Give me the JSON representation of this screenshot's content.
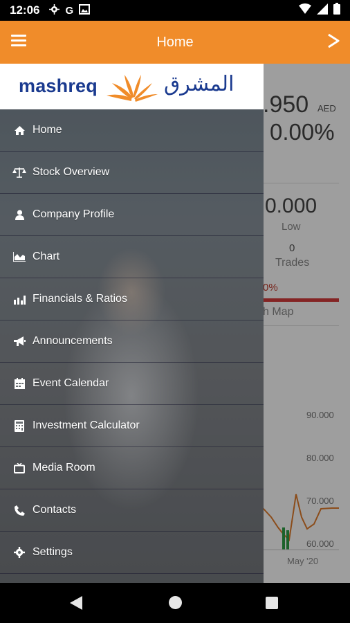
{
  "status_bar": {
    "time": "12:06",
    "icons": [
      "gear-icon",
      "google-icon",
      "photo-icon",
      "wifi-icon",
      "cellular-icon",
      "battery-icon"
    ],
    "google_letter": "G"
  },
  "app_bar": {
    "title": "Home",
    "menu_icon": "hamburger-icon",
    "share_icon": "chevron-right-icon",
    "color": "#f08c2a"
  },
  "drawer": {
    "brand_en": "mashreq",
    "brand_ar": "المشرق",
    "brand_color": "#1a3a8f",
    "items": [
      {
        "label": "Home",
        "icon": "home-icon"
      },
      {
        "label": "Stock Overview",
        "icon": "scale-icon"
      },
      {
        "label": "Company Profile",
        "icon": "person-icon"
      },
      {
        "label": "Chart",
        "icon": "area-chart-icon"
      },
      {
        "label": "Financials & Ratios",
        "icon": "bar-chart-icon"
      },
      {
        "label": "Announcements",
        "icon": "megaphone-icon"
      },
      {
        "label": "Event Calendar",
        "icon": "calendar-icon"
      },
      {
        "label": "Investment Calculator",
        "icon": "calculator-icon"
      },
      {
        "label": "Media Room",
        "icon": "tv-icon"
      },
      {
        "label": "Contacts",
        "icon": "phone-icon"
      },
      {
        "label": "Settings",
        "icon": "gear-icon"
      }
    ]
  },
  "main": {
    "price": ".950",
    "price_unit": "AED",
    "change": "0.00%",
    "low_value": "0.000",
    "low_label": "Low",
    "trades_value": "0",
    "trades_label": "Trades",
    "percent": "0%",
    "heat_map_label": "h Map",
    "y_ticks": [
      "90.000",
      "80.000",
      "70.000",
      "60.000"
    ],
    "x_tick": "May '20"
  },
  "nav_bar": {
    "icons": [
      "back-icon",
      "home-circle-icon",
      "recents-icon"
    ]
  }
}
